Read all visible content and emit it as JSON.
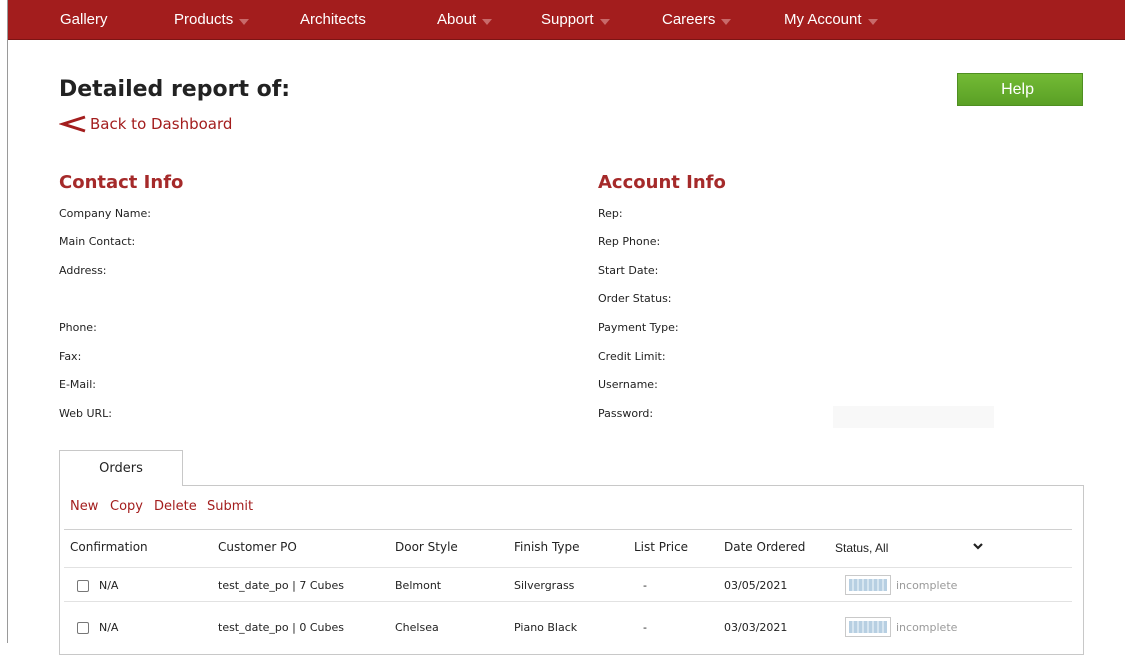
{
  "nav": {
    "items": [
      {
        "label": "Gallery",
        "has_dropdown": false
      },
      {
        "label": "Products",
        "has_dropdown": true
      },
      {
        "label": "Architects",
        "has_dropdown": false
      },
      {
        "label": "About",
        "has_dropdown": true
      },
      {
        "label": "Support",
        "has_dropdown": true
      },
      {
        "label": "Careers",
        "has_dropdown": true
      },
      {
        "label": "My Account",
        "has_dropdown": true
      }
    ]
  },
  "header": {
    "title": "Detailed report of:",
    "back_link": "Back to Dashboard",
    "help_button": "Help"
  },
  "contact_info": {
    "heading": "Contact Info",
    "labels": [
      "Company Name:",
      "Main Contact:",
      "Address:",
      "Phone:",
      "Fax:",
      "E-Mail:",
      "Web URL:"
    ]
  },
  "account_info": {
    "heading": "Account Info",
    "labels": [
      "Rep:",
      "Rep Phone:",
      "Start Date:",
      "Order Status:",
      "Payment Type:",
      "Credit Limit:",
      "Username:",
      "Password:"
    ]
  },
  "orders": {
    "tab_label": "Orders",
    "toolbar": [
      "New",
      "Copy",
      "Delete",
      "Submit"
    ],
    "columns": [
      "Confirmation",
      "Customer PO",
      "Door Style",
      "Finish Type",
      "List Price",
      "Date Ordered"
    ],
    "status_filter": "Status, All",
    "rows": [
      {
        "confirmation": "N/A",
        "customer_po": "test_date_po | 7 Cubes",
        "door_style": "Belmont",
        "finish_type": "Silvergrass",
        "list_price": "-",
        "date_ordered": "03/05/2021",
        "status": "incomplete",
        "progress": 1.0
      },
      {
        "confirmation": "N/A",
        "customer_po": "test_date_po | 0 Cubes",
        "door_style": "Chelsea",
        "finish_type": "Piano Black",
        "list_price": "-",
        "date_ordered": "03/03/2021",
        "status": "incomplete",
        "progress": 1.0
      }
    ]
  },
  "colors": {
    "nav_background": "#a31d1d",
    "heading_accent": "#a52a2a",
    "help_button": "#6ab02e",
    "link": "#a31d1d"
  },
  "icons": {
    "back": "chevron-left-icon",
    "status_dropdown": "chevron-down-icon",
    "nav_dropdown": "caret-down-icon"
  }
}
